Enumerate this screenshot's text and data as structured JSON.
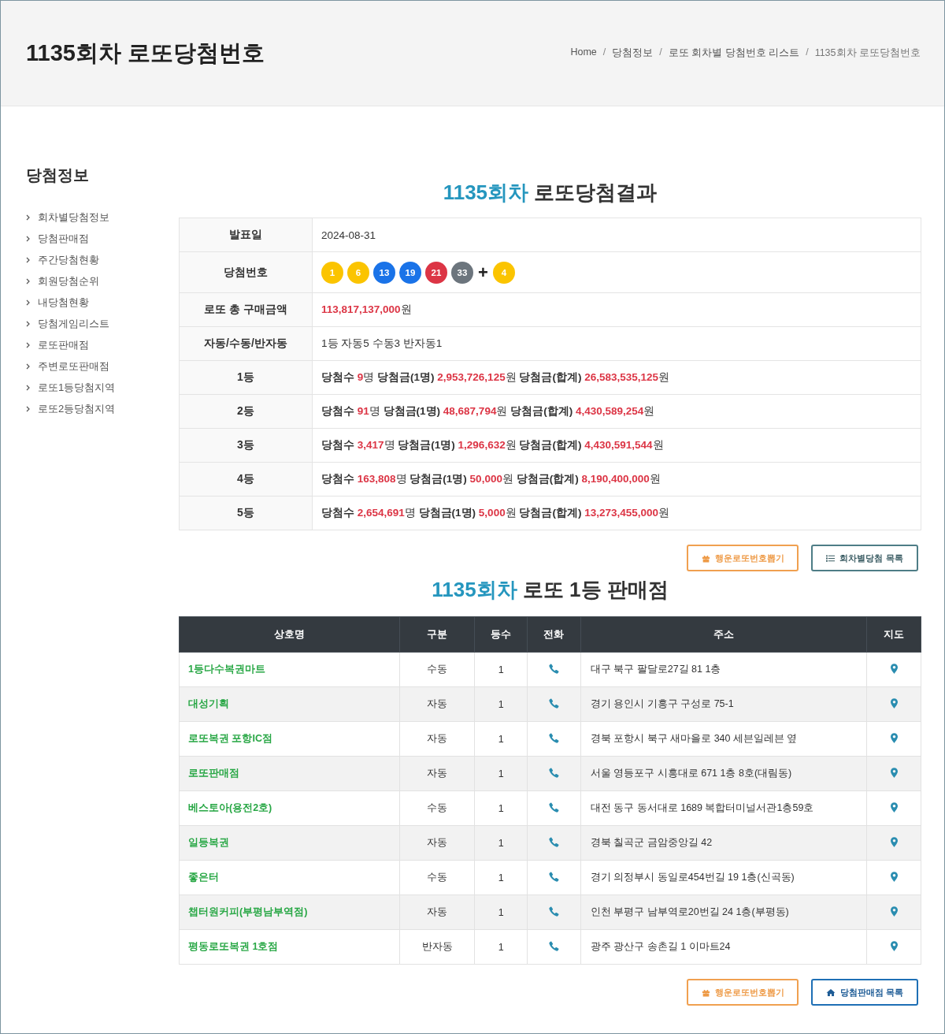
{
  "header": {
    "title": "1135회차 로또당첨번호",
    "breadcrumb_separator": "/",
    "breadcrumb": [
      "Home",
      "당첨정보",
      "로또 회차별 당첨번호 리스트",
      "1135회차 로또당첨번호"
    ]
  },
  "sidebar": {
    "title": "당첨정보",
    "items": [
      "회차별당첨정보",
      "당첨판매점",
      "주간당첨현황",
      "회원당첨순위",
      "내당첨현황",
      "당첨게임리스트",
      "로또판매점",
      "주변로또판매점",
      "로또1등당첨지역",
      "로또2등당첨지역"
    ]
  },
  "result": {
    "title_highlight": "1135회차",
    "title_rest": "로또당첨결과",
    "date_label": "발표일",
    "date": "2024-08-31",
    "numbers_label": "당첨번호",
    "balls": [
      {
        "number": "1",
        "color": "#fbc400"
      },
      {
        "number": "6",
        "color": "#fbc400"
      },
      {
        "number": "13",
        "color": "#1a73e8"
      },
      {
        "number": "19",
        "color": "#1a73e8"
      },
      {
        "number": "21",
        "color": "#dc3545"
      },
      {
        "number": "33",
        "color": "#6c757d"
      }
    ],
    "plus": "+",
    "bonus": {
      "number": "4",
      "color": "#fbc400"
    },
    "sales_label": "로또 총 구매금액",
    "sales": "113,817,137,000",
    "sales_unit": "원",
    "method_label": "자동/수동/반자동",
    "method": "1등 자동5 수동3 반자동1",
    "prizes": [
      {
        "rank": "1등",
        "count_label": "당첨수",
        "count": "9",
        "count_unit": "명",
        "each_label": "당첨금(1명)",
        "each": "2,953,726,125",
        "each_unit": "원",
        "total_label": "당첨금(합계)",
        "total": "26,583,535,125",
        "total_unit": "원"
      },
      {
        "rank": "2등",
        "count_label": "당첨수",
        "count": "91",
        "count_unit": "명",
        "each_label": "당첨금(1명)",
        "each": "48,687,794",
        "each_unit": "원",
        "total_label": "당첨금(합계)",
        "total": "4,430,589,254",
        "total_unit": "원"
      },
      {
        "rank": "3등",
        "count_label": "당첨수",
        "count": "3,417",
        "count_unit": "명",
        "each_label": "당첨금(1명)",
        "each": "1,296,632",
        "each_unit": "원",
        "total_label": "당첨금(합계)",
        "total": "4,430,591,544",
        "total_unit": "원"
      },
      {
        "rank": "4등",
        "count_label": "당첨수",
        "count": "163,808",
        "count_unit": "명",
        "each_label": "당첨금(1명)",
        "each": "50,000",
        "each_unit": "원",
        "total_label": "당첨금(합계)",
        "total": "8,190,400,000",
        "total_unit": "원"
      },
      {
        "rank": "5등",
        "count_label": "당첨수",
        "count": "2,654,691",
        "count_unit": "명",
        "each_label": "당첨금(1명)",
        "each": "5,000",
        "each_unit": "원",
        "total_label": "당첨금(합계)",
        "total": "13,273,455,000",
        "total_unit": "원"
      }
    ],
    "buttons": [
      {
        "label": "행운로또번호뽑기",
        "kind": "lucky"
      },
      {
        "label": "회차별당첨 목록",
        "kind": "list"
      }
    ]
  },
  "stores": {
    "title_highlight": "1135회차",
    "title_rest": "로또 1등 판매점",
    "columns": [
      "상호명",
      "구분",
      "등수",
      "전화",
      "주소",
      "지도"
    ],
    "rows": [
      {
        "name": "1등다수복권마트",
        "type": "수동",
        "rank": "1",
        "address": "대구 북구 팔달로27길 81 1층"
      },
      {
        "name": "대성기획",
        "type": "자동",
        "rank": "1",
        "address": "경기 용인시 기흥구 구성로 75-1"
      },
      {
        "name": "로또복권 포항IC점",
        "type": "자동",
        "rank": "1",
        "address": "경북 포항시 북구 새마을로 340 세븐일레븐 옆"
      },
      {
        "name": "로또판매점",
        "type": "자동",
        "rank": "1",
        "address": "서울 영등포구 시흥대로 671 1층 8호(대림동)"
      },
      {
        "name": "베스토아(용전2호)",
        "type": "수동",
        "rank": "1",
        "address": "대전 동구 동서대로 1689 복합터미널서관1층59호"
      },
      {
        "name": "일등복권",
        "type": "자동",
        "rank": "1",
        "address": "경북 칠곡군 금암중앙길 42"
      },
      {
        "name": "좋은터",
        "type": "수동",
        "rank": "1",
        "address": "경기 의정부시 동일로454번길 19 1층(신곡동)"
      },
      {
        "name": "챕터원커피(부평남부역점)",
        "type": "자동",
        "rank": "1",
        "address": "인천 부평구 남부역로20번길 24 1층(부평동)"
      },
      {
        "name": "평동로또복권 1호점",
        "type": "반자동",
        "rank": "1",
        "address": "광주 광산구 송촌길 1 이마트24"
      }
    ],
    "buttons": [
      {
        "label": "행운로또번호뽑기",
        "kind": "lucky"
      },
      {
        "label": "당첨판매점 목록",
        "kind": "home"
      }
    ]
  }
}
